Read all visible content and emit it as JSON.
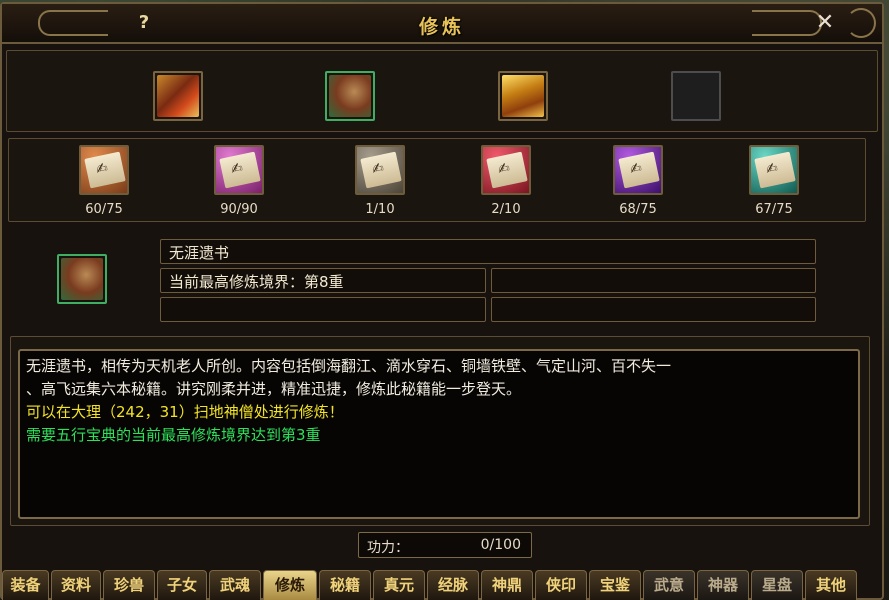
{
  "window": {
    "title": "修炼",
    "help": "?",
    "close": "✕"
  },
  "top_icons": [
    {
      "name": "red-book-icon"
    },
    {
      "name": "scroll-bundle-icon"
    },
    {
      "name": "gold-book-stack-icon"
    },
    {
      "name": "empty-slot"
    }
  ],
  "scrolls": [
    {
      "count": "60/75",
      "color": "#7a3b18"
    },
    {
      "count": "90/90",
      "color": "#7a1f6a"
    },
    {
      "count": "1/10",
      "color": "#4c4438"
    },
    {
      "count": "2/10",
      "color": "#7a1520"
    },
    {
      "count": "68/75",
      "color": "#3c0f6a"
    },
    {
      "count": "67/75",
      "color": "#0f5a50"
    }
  ],
  "detail": {
    "book_name": "无涯遗书",
    "realm": "当前最高修炼境界：第8重",
    "empty1": "",
    "empty2": "",
    "empty3": ""
  },
  "description": {
    "line1": "无涯遗书，相传为天机老人所创。内容包括倒海翻江、滴水穿石、铜墙铁壁、气定山河、百不失一",
    "line2": "、高飞远集六本秘籍。讲究刚柔并进，精准迅捷，修炼此秘籍能一步登天。",
    "line3": "可以在大理（242，31）扫地神僧处进行修炼！",
    "line4": "需要五行宝典的当前最高修炼境界达到第3重"
  },
  "power": {
    "label": "功力：",
    "value": "0/100"
  },
  "tabs": [
    {
      "label": "装备",
      "state": "normal"
    },
    {
      "label": "资料",
      "state": "normal"
    },
    {
      "label": "珍兽",
      "state": "normal"
    },
    {
      "label": "子女",
      "state": "normal"
    },
    {
      "label": "武魂",
      "state": "normal"
    },
    {
      "label": "修炼",
      "state": "active"
    },
    {
      "label": "秘籍",
      "state": "normal"
    },
    {
      "label": "真元",
      "state": "normal"
    },
    {
      "label": "经脉",
      "state": "normal"
    },
    {
      "label": "神鼎",
      "state": "normal"
    },
    {
      "label": "侠印",
      "state": "normal"
    },
    {
      "label": "宝鉴",
      "state": "normal"
    },
    {
      "label": "武意",
      "state": "dim"
    },
    {
      "label": "神器",
      "state": "dim"
    },
    {
      "label": "星盘",
      "state": "dim"
    },
    {
      "label": "其他",
      "state": "normal"
    }
  ]
}
